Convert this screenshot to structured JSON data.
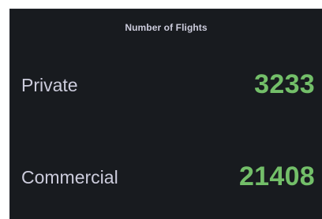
{
  "panel": {
    "title": "Number of Flights",
    "value_color": "#73bf69",
    "stats": [
      {
        "label": "Private",
        "value": "3233"
      },
      {
        "label": "Commercial",
        "value": "21408"
      }
    ]
  }
}
